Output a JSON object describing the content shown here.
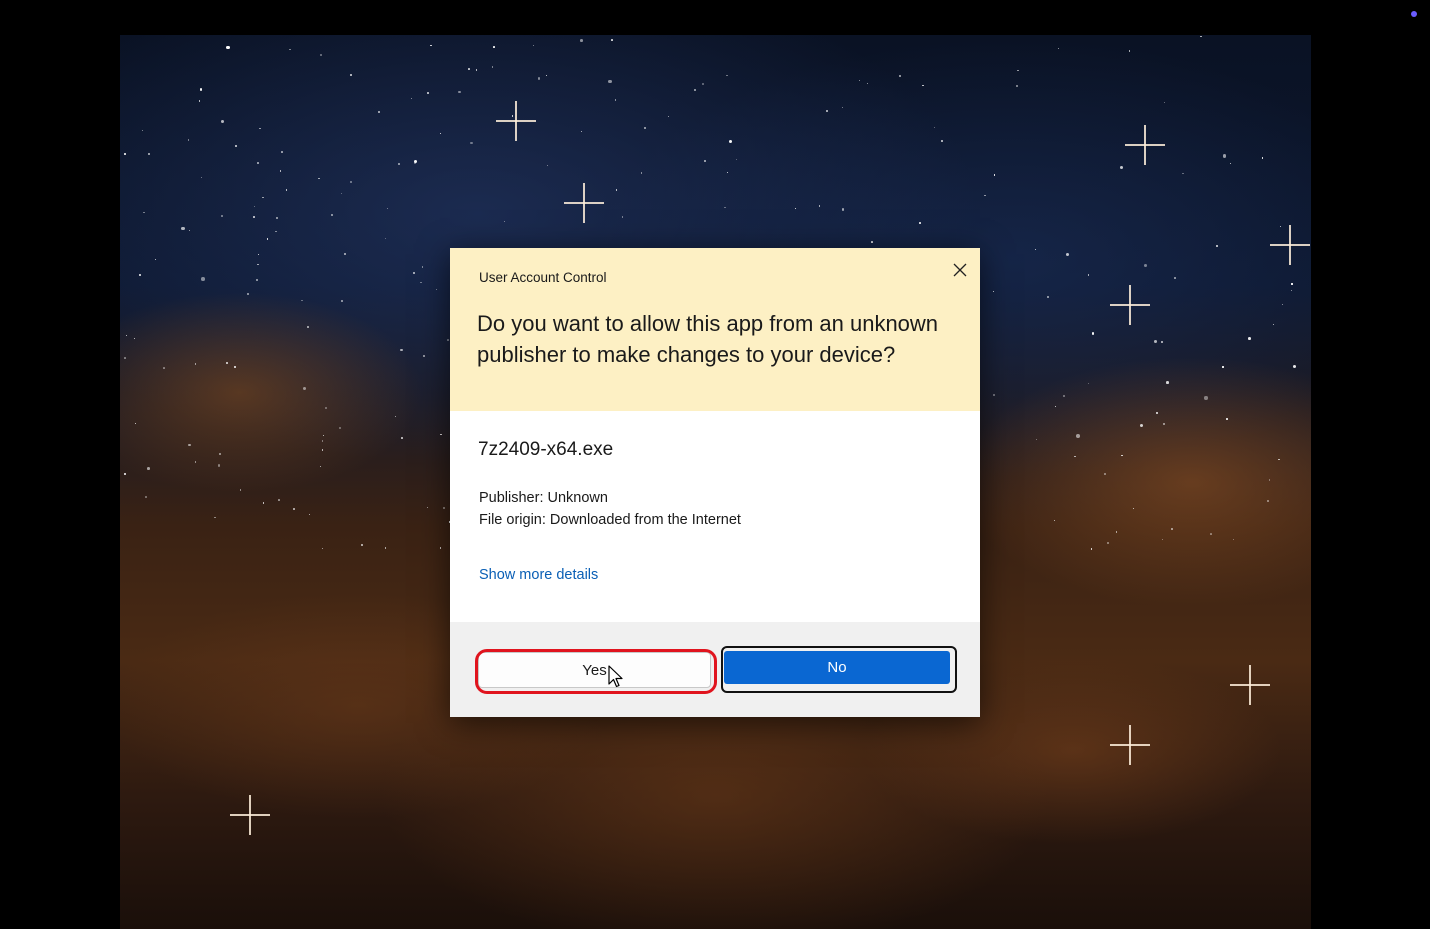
{
  "dialog": {
    "title": "User Account Control",
    "question": "Do you want to allow this app from an unknown publisher to make changes to your device?",
    "app_name": "7z2409-x64.exe",
    "publisher": "Publisher: Unknown",
    "file_origin": "File origin: Downloaded from the Internet",
    "details_link": "Show more details",
    "yes_label": "Yes",
    "no_label": "No",
    "close_icon": "close-icon",
    "highlight_color": "#e0141e",
    "header_color": "#fdf0c4",
    "primary_color": "#0a67d2",
    "link_color": "#0a5fb5"
  }
}
